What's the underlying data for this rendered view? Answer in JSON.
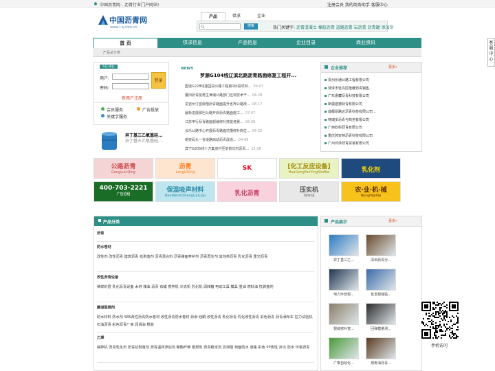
{
  "topbar": {
    "left_text": "中国沥青网 - 沥青行业门户网站!",
    "links": "注册会员  我的商务助手  客服中心"
  },
  "logo": {
    "title": "中国沥青网",
    "subtitle": "www.l-q.com.cn"
  },
  "search": {
    "tabs": [
      "产品",
      "供求",
      "企业"
    ],
    "button": "搜索",
    "hot_label": "热门关键字:",
    "hot_words": "沥青混凝土 橡胶沥青 道路沥青 岩沥青 沥青罐 添加剂"
  },
  "nav": [
    "首 页",
    "供求信息",
    "产品信息",
    "企业目录",
    "商业资讯"
  ],
  "breadcrumb": "产品总分类",
  "login": {
    "badge": "今日·排名·",
    "user_label": "用户:",
    "pass_label": "密码:",
    "login_button": "登录",
    "register": "新用户注册",
    "links": [
      "会员服务",
      "广告投放",
      "关键字服务"
    ],
    "promo_title": "异丁基三乙氧基硅...",
    "promo_desc": "异丁基三乙氧基硅..."
  },
  "news": {
    "badge": "NEWS",
    "headline": "罗源G104线辽滨北路沥青路面修复工程开...",
    "items": [
      {
        "t": "国道G228线莲园段公路工程第1标段项目...",
        "d": "09-07"
      },
      {
        "t": "厦旧沥青能再生津浦公路部门还现技术干...",
        "d": "08-28"
      },
      {
        "t": "龙岩长汀首鼎偕沥青路面提升省界公路改...",
        "d": "08-17"
      },
      {
        "t": "最新进展那巴公路开启沥青路面施工...",
        "d": "07-07"
      },
      {
        "t": "江苏甲行沥青路面裂缝修补技能竞赛...",
        "d": "06-09"
      },
      {
        "t": "长乐公路中心开展沥青路面坑槽修补岗位...",
        "d": "05-22"
      },
      {
        "t": "南安码头一省道路启动沥青改造...",
        "d": "04-09"
      },
      {
        "t": "宾宁G205线十方集资村至前前坑村沥青...",
        "d": "12-26"
      }
    ]
  },
  "enterprise": {
    "title": "企业推荐",
    "more": "更多»",
    "items": [
      "贵州长通公路工程有限公司",
      "菏泽市牡丹区隆耀沥青销售...",
      "广东惠藏沥青科技有限公司",
      "新疆建德沥青有限公司",
      "成都昂路达沥青科技有限公司...",
      "特瑞多沥青与商务有限公司",
      "广西钦科沥青有限公司",
      "重庆骋安特沥青科技有限公司",
      "广州鸿泽沥青贸易有限公司"
    ]
  },
  "ads": {
    "row1": [
      {
        "main": "公路沥青",
        "sub": "GongLuLiQing",
        "bg": "#f4d4d4",
        "fg": "#c94a4a"
      },
      {
        "main": "沥青",
        "sub": "LengLiQing",
        "bg": "#fde5cf",
        "fg": "#ff7b1c"
      },
      {
        "main": "SK",
        "sub": "",
        "bg": "#ffffff",
        "fg": "#e3001b"
      },
      {
        "main": "[化工反应设备]",
        "sub": "HuaGongFanYingSheBei",
        "bg": "#e8f2c4",
        "fg": "#a08a00"
      },
      {
        "main": "乳化剂",
        "sub": "",
        "bg": "#1e4a7d",
        "fg": "#f4d400"
      }
    ],
    "row2": [
      {
        "main": "400-703-2221",
        "sub": "广告招租",
        "bg": "#1a6d26",
        "fg": "#ffffff"
      },
      {
        "main": "保温吸声材料",
        "sub": "BaoWenXiShengCaiLiao",
        "bg": "#bfe6ef",
        "fg": "#2d8aa8"
      },
      {
        "main": "乳化沥青",
        "sub": "",
        "bg": "#f8d2dd",
        "fg": "#c84468"
      },
      {
        "main": "压实机",
        "sub": "YaShiJi",
        "bg": "#e8e8e8",
        "fg": "#555555"
      },
      {
        "main": "农·业·机·械",
        "sub": "NongYeJiXie",
        "bg": "#f7c21b",
        "fg": "#5a2a00"
      }
    ]
  },
  "categories": {
    "title": "产品分类",
    "groups": [
      {
        "name": "沥青",
        "items": ""
      },
      {
        "name": "防水卷材",
        "items": "改性剂  改性沥青  建筑沥青  抗剥落剂  沥青混合料  沥青路面养护剂  沥青再生剂  其他类沥青  乳化沥青  重交沥青"
      },
      {
        "name": "改性沥青设备",
        "items": "稀浆封层  乳化沥青设备  木材  煤油  沥青  石蜡  搅拌机  冷冻机  乳化机  周转箱  电动工具  模具  重油  燃料油  抗剥落剂"
      },
      {
        "name": "雕道阻燃剂",
        "items": "防水材料  防水剂  SBS改性沥青防水卷材  改性沥青防水卷材  沥滑  硅酮  改性沥青  乳化沥青  乳化改性沥青  彩色沥青  沥青洒布车  拉力试验机  石油沥青  彩色沥青厂家  润滑油  橡胶"
      },
      {
        "name": "乙烯",
        "items": "碱碎机  沥青乳化剂  沥青抗剥落剂  沥青温拌添加剂  聚酯纤维  阻燃剂  沥青稳定剂  抗滑阻  桥面防水  道路  彩色  PP改性  沫沉  防水  环氧沥青"
      }
    ]
  },
  "products": {
    "title": "产品展示",
    "more": "更多»",
    "items": [
      "异丁基三乙...",
      "深圳沥青分...",
      "电力环管裂...",
      "批发裂缝贴...",
      "裂缝修补宽...",
      "回弹模量测...",
      "广泰自动化...",
      "煤焦油沥青..."
    ]
  },
  "side": {
    "kefu": "客服中心",
    "qr_label": "手机访问"
  },
  "colors": {
    "theme": "#2e8f87",
    "link_blue": "#1b5a9b"
  }
}
